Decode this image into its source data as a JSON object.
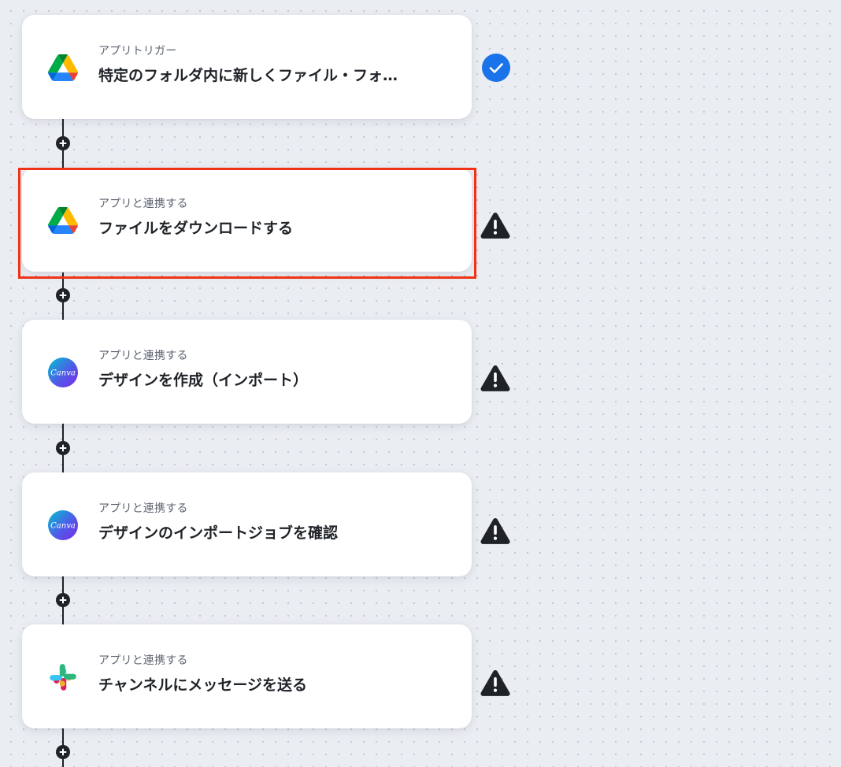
{
  "flow": {
    "steps": [
      {
        "caption": "アプリトリガー",
        "title": "特定のフォルダ内に新しくファイル・フォ…",
        "app_icon": "google-drive-icon",
        "status": "check-icon"
      },
      {
        "caption": "アプリと連携する",
        "title": "ファイルをダウンロードする",
        "app_icon": "google-drive-icon",
        "status": "warning-icon",
        "highlighted": true
      },
      {
        "caption": "アプリと連携する",
        "title": "デザインを作成（インポート）",
        "app_icon": "canva-icon",
        "app_icon_text": "Canva",
        "status": "warning-icon"
      },
      {
        "caption": "アプリと連携する",
        "title": "デザインのインポートジョブを確認",
        "app_icon": "canva-icon",
        "app_icon_text": "Canva",
        "status": "warning-icon"
      },
      {
        "caption": "アプリと連携する",
        "title": "チャンネルにメッセージを送る",
        "app_icon": "slack-icon",
        "status": "warning-icon"
      }
    ],
    "add_button_icon": "plus-icon",
    "colors": {
      "background": "#eaedf2",
      "card": "#ffffff",
      "text": "#1f2328",
      "caption": "#5b6270",
      "check": "#1a73e8",
      "warning": "#1f2328",
      "selection": "#f03216",
      "canva_gradient": [
        "#00c4cc",
        "#7d2ae8"
      ]
    }
  }
}
